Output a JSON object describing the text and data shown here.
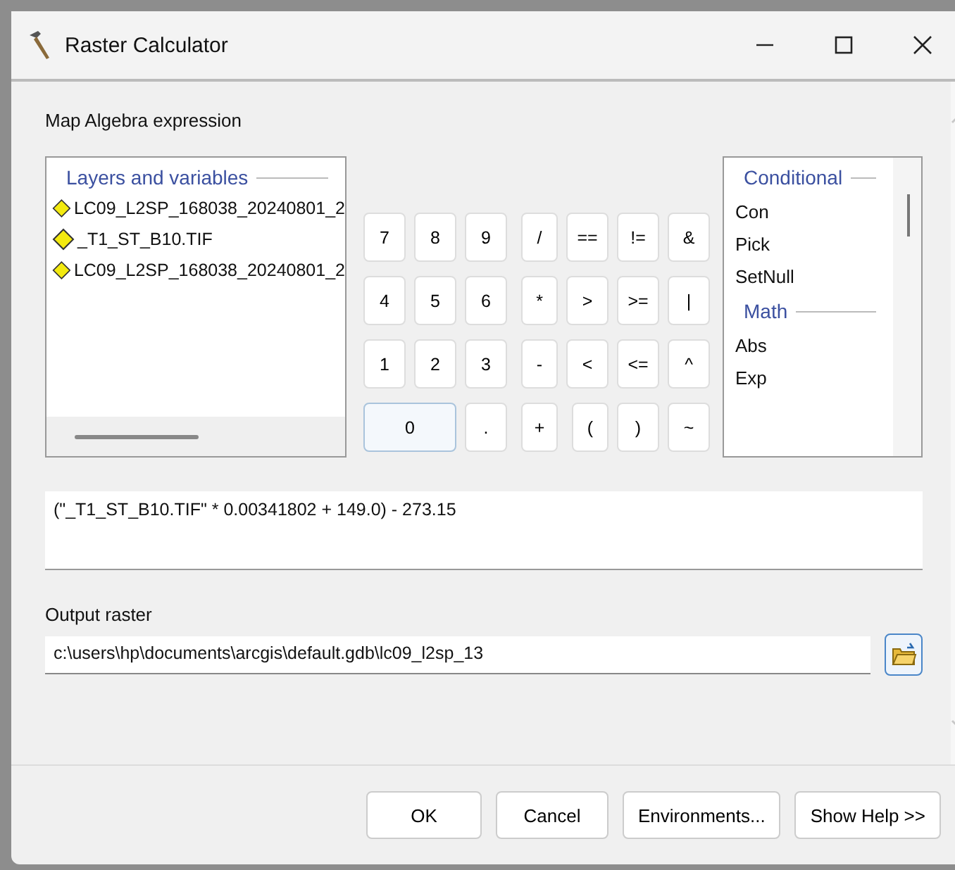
{
  "window": {
    "title": "Raster Calculator"
  },
  "expression_label": "Map Algebra expression",
  "layers": {
    "heading": "Layers and variables",
    "items": [
      {
        "name": "LC09_L2SP_168038_20240801_2"
      },
      {
        "name": "_T1_ST_B10.TIF"
      },
      {
        "name": "LC09_L2SP_168038_20240801_2"
      }
    ]
  },
  "keypad": [
    {
      "label": "7",
      "kind": "key"
    },
    {
      "label": "8",
      "kind": "key"
    },
    {
      "label": "9",
      "kind": "key"
    },
    {
      "label": "/",
      "kind": "key"
    },
    {
      "label": "==",
      "kind": "key"
    },
    {
      "label": "!=",
      "kind": "key"
    },
    {
      "label": "&",
      "kind": "key"
    },
    {
      "label": "4",
      "kind": "key"
    },
    {
      "label": "5",
      "kind": "key"
    },
    {
      "label": "6",
      "kind": "key"
    },
    {
      "label": "*",
      "kind": "key"
    },
    {
      "label": ">",
      "kind": "key"
    },
    {
      "label": ">=",
      "kind": "key"
    },
    {
      "label": "|",
      "kind": "key"
    },
    {
      "label": "1",
      "kind": "key"
    },
    {
      "label": "2",
      "kind": "key"
    },
    {
      "label": "3",
      "kind": "key"
    },
    {
      "label": "-",
      "kind": "key"
    },
    {
      "label": "<",
      "kind": "key"
    },
    {
      "label": "<=",
      "kind": "key"
    },
    {
      "label": "^",
      "kind": "key"
    },
    {
      "label": "0",
      "kind": "wide"
    },
    {
      "label": ".",
      "kind": "key"
    },
    {
      "label": "+",
      "kind": "key"
    },
    {
      "label": "(",
      "kind": "key"
    },
    {
      "label": ")",
      "kind": "key"
    },
    {
      "label": "~",
      "kind": "key"
    }
  ],
  "functions": [
    {
      "heading": "Conditional",
      "items": [
        "Con",
        "Pick",
        "SetNull"
      ]
    },
    {
      "heading": "Math",
      "items": [
        "Abs",
        "Exp"
      ]
    }
  ],
  "expression": "(\"_T1_ST_B10.TIF\" * 0.00341802 + 149.0) - 273.15",
  "output": {
    "label": "Output raster",
    "value": "c:\\users\\hp\\documents\\arcgis\\default.gdb\\lc09_l2sp_13"
  },
  "buttons": [
    "OK",
    "Cancel",
    "Environments...",
    "Show Help >>"
  ]
}
